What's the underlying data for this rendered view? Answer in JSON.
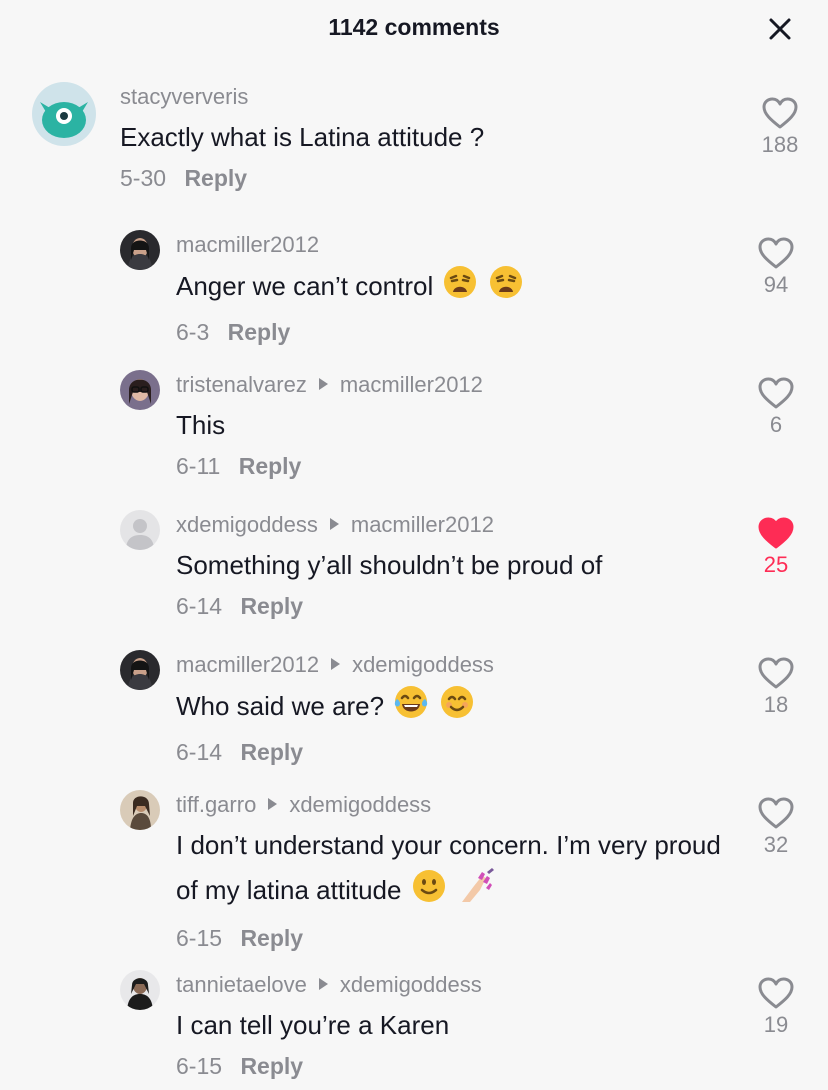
{
  "header": {
    "title": "1142 comments"
  },
  "comments": [
    {
      "user": "stacyververis",
      "reply_to": "",
      "text": "Exactly what is Latina attitude ?",
      "emojis": [],
      "date": "5-30",
      "reply_label": "Reply",
      "likes": "188",
      "liked": false
    },
    {
      "user": "macmiller2012",
      "reply_to": "",
      "text": "Anger we can’t control",
      "emojis": [
        "weary-face-emoji",
        "weary-face-emoji"
      ],
      "date": "6-3",
      "reply_label": "Reply",
      "likes": "94",
      "liked": false
    },
    {
      "user": "tristenalvarez",
      "reply_to": "macmiller2012",
      "text": "This",
      "emojis": [],
      "date": "6-11",
      "reply_label": "Reply",
      "likes": "6",
      "liked": false
    },
    {
      "user": "xdemigoddess",
      "reply_to": "macmiller2012",
      "text": "Something y’all shouldn’t be proud of",
      "emojis": [],
      "date": "6-14",
      "reply_label": "Reply",
      "likes": "25",
      "liked": true
    },
    {
      "user": "macmiller2012",
      "reply_to": "xdemigoddess",
      "text": "Who said we are?",
      "emojis": [
        "tears-of-joy-emoji",
        "smiling-face-emoji"
      ],
      "date": "6-14",
      "reply_label": "Reply",
      "likes": "18",
      "liked": false
    },
    {
      "user": "tiff.garro",
      "reply_to": "xdemigoddess",
      "text": "I don’t understand your concern. I’m very proud of my latina attitude",
      "emojis": [
        "slightly-smiling-face-emoji",
        "nail-polish-emoji"
      ],
      "date": "6-15",
      "reply_label": "Reply",
      "likes": "32",
      "liked": false
    },
    {
      "user": "tannietaelove",
      "reply_to": "xdemigoddess",
      "text": "I can tell you’re a Karen",
      "emojis": [],
      "date": "6-15",
      "reply_label": "Reply",
      "likes": "19",
      "liked": false
    }
  ],
  "colors": {
    "text": "#161823",
    "muted": "#8a8b91",
    "like_active": "#fe2c55",
    "background": "#f7f7f7"
  },
  "icons": {
    "close": "close-icon",
    "like": "heart-outline-icon",
    "liked": "heart-filled-icon",
    "thread_arrow": "reply-arrow-icon"
  }
}
